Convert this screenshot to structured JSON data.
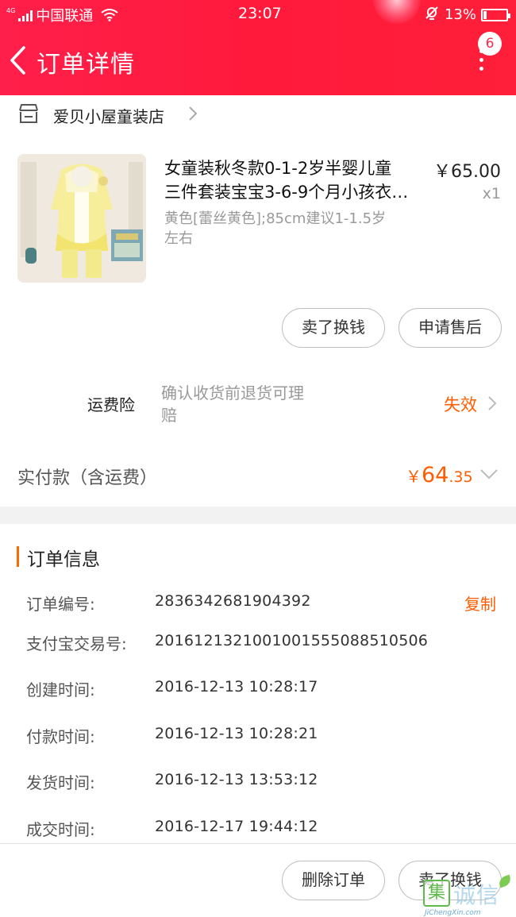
{
  "status_bar": {
    "network": "4G",
    "carrier": "中国联通",
    "time": "23:07",
    "battery": "13%"
  },
  "nav": {
    "title": "订单详情",
    "badge": "6"
  },
  "shop": {
    "name": "爱贝小屋童装店"
  },
  "product": {
    "title_line1": "女童装秋冬款0-1-2岁半婴儿童",
    "title_line2": "三件套装宝宝3-6-9个月小孩衣…",
    "sku_line1": "黄色[蕾丝黄色];85cm建议1-1.5岁",
    "sku_line2": "左右",
    "price": "￥65.00",
    "qty": "x1"
  },
  "actions": {
    "sell": "卖了换钱",
    "after_sale": "申请售后"
  },
  "insurance": {
    "label": "运费险",
    "desc_line1": "确认收货前退货可理",
    "desc_line2": "赔",
    "status": "失效"
  },
  "payment": {
    "label": "实付款（含运费）",
    "currency": "￥",
    "amount_int": "64",
    "amount_dec": ".35"
  },
  "order_info": {
    "title": "订单信息",
    "copy": "复制",
    "rows": [
      {
        "key": "订单编号:",
        "value": "2836342681904392"
      },
      {
        "key": "支付宝交易号:",
        "value": "2016121321001001555088510506"
      },
      {
        "key": "创建时间:",
        "value": "2016-12-13 10:28:17"
      },
      {
        "key": "付款时间:",
        "value": "2016-12-13 10:28:21"
      },
      {
        "key": "发货时间:",
        "value": "2016-12-13 13:53:12"
      },
      {
        "key": "成交时间:",
        "value": "2016-12-17 19:44:12"
      }
    ]
  },
  "bottom": {
    "delete": "删除订单",
    "sell": "卖了换钱"
  },
  "watermark": {
    "box": "集",
    "text": "诚信",
    "url": "JiChengXin.com"
  },
  "colors": {
    "header": "#ff1f44",
    "accent": "#ff5c00"
  }
}
